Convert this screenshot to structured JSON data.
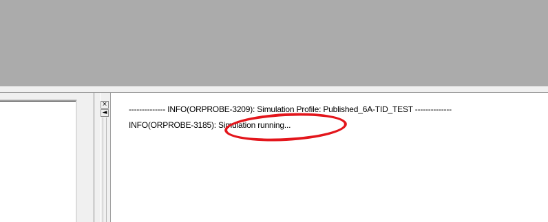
{
  "log": {
    "lines": [
      "-------------- INFO(ORPROBE-3209): Simulation Profile:  Published_6A-TID_TEST --------------",
      "INFO(ORPROBE-3185): Simulation running..."
    ]
  },
  "dock": {
    "close_glyph": "×",
    "arrow_glyph": "◄",
    "close_icon": "close-icon",
    "arrow_icon": "arrow-left-icon"
  },
  "annotation": {
    "color": "#e3161c",
    "shape": "ellipse"
  },
  "colors": {
    "mdi_background": "#ababab",
    "pane_background": "#ffffff",
    "frame": "#f0f0f0"
  }
}
